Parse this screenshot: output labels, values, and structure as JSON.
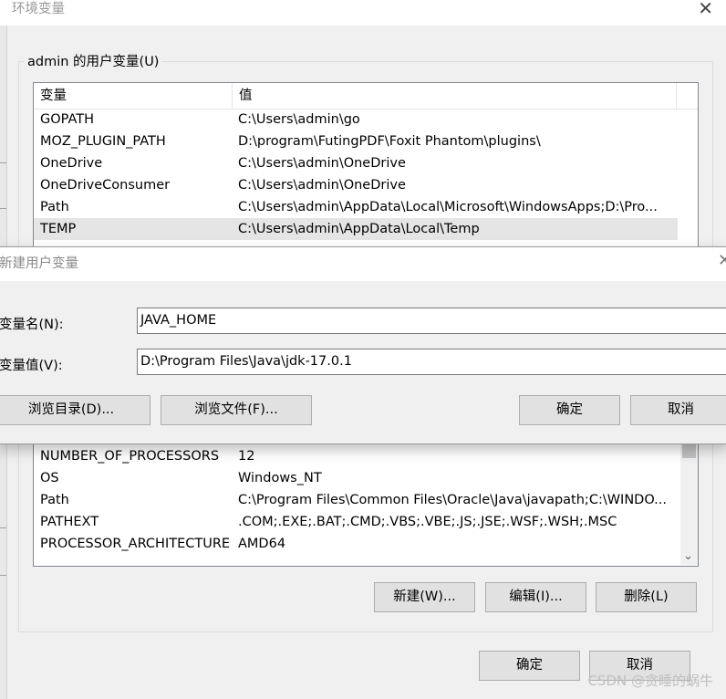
{
  "background_window": {
    "title": "环境变量",
    "close_glyph": "✕",
    "user_group_label": "admin 的用户变量(U)",
    "user_vars": {
      "columns": [
        "变量",
        "值"
      ],
      "rows": [
        {
          "name": "GOPATH",
          "value": "C:\\Users\\admin\\go"
        },
        {
          "name": "MOZ_PLUGIN_PATH",
          "value": "D:\\program\\FutingPDF\\Foxit Phantom\\plugins\\"
        },
        {
          "name": "OneDrive",
          "value": "C:\\Users\\admin\\OneDrive"
        },
        {
          "name": "OneDriveConsumer",
          "value": "C:\\Users\\admin\\OneDrive"
        },
        {
          "name": "Path",
          "value": "C:\\Users\\admin\\AppData\\Local\\Microsoft\\WindowsApps;D:\\Pro..."
        },
        {
          "name": "TEMP",
          "value": "C:\\Users\\admin\\AppData\\Local\\Temp",
          "selected": true
        }
      ]
    },
    "system_vars": {
      "rows": [
        {
          "name": "NUMBER_OF_PROCESSORS",
          "value": "12"
        },
        {
          "name": "OS",
          "value": "Windows_NT"
        },
        {
          "name": "Path",
          "value": "C:\\Program Files\\Common Files\\Oracle\\Java\\javapath;C:\\WINDO..."
        },
        {
          "name": "PATHEXT",
          "value": ".COM;.EXE;.BAT;.CMD;.VBS;.VBE;.JS;.JSE;.WSF;.WSH;.MSC"
        },
        {
          "name": "PROCESSOR_ARCHITECTURE",
          "value": "AMD64"
        }
      ],
      "new_button": "新建(W)...",
      "edit_button": "编辑(I)...",
      "delete_button": "删除(L)"
    },
    "ok_button": "确定",
    "cancel_button": "取消"
  },
  "dialog": {
    "title": "新建用户变量",
    "close_glyph": "✕",
    "name_label": "变量名(N):",
    "name_value": "JAVA_HOME",
    "value_label": "变量值(V):",
    "value_value": "D:\\Program Files\\Java\\jdk-17.0.1",
    "browse_dir_button": "浏览目录(D)...",
    "browse_file_button": "浏览文件(F)...",
    "ok_button": "确定",
    "cancel_button": "取消"
  },
  "watermark": "CSDN @贪睡的蜗牛",
  "icons": {
    "scroll_down": "chevron-down-icon",
    "close": "close-icon"
  },
  "colors": {
    "selected_row": "#e5e5e5",
    "button_face": "#e1e1e1",
    "window_bg": "#f0f0f0"
  }
}
